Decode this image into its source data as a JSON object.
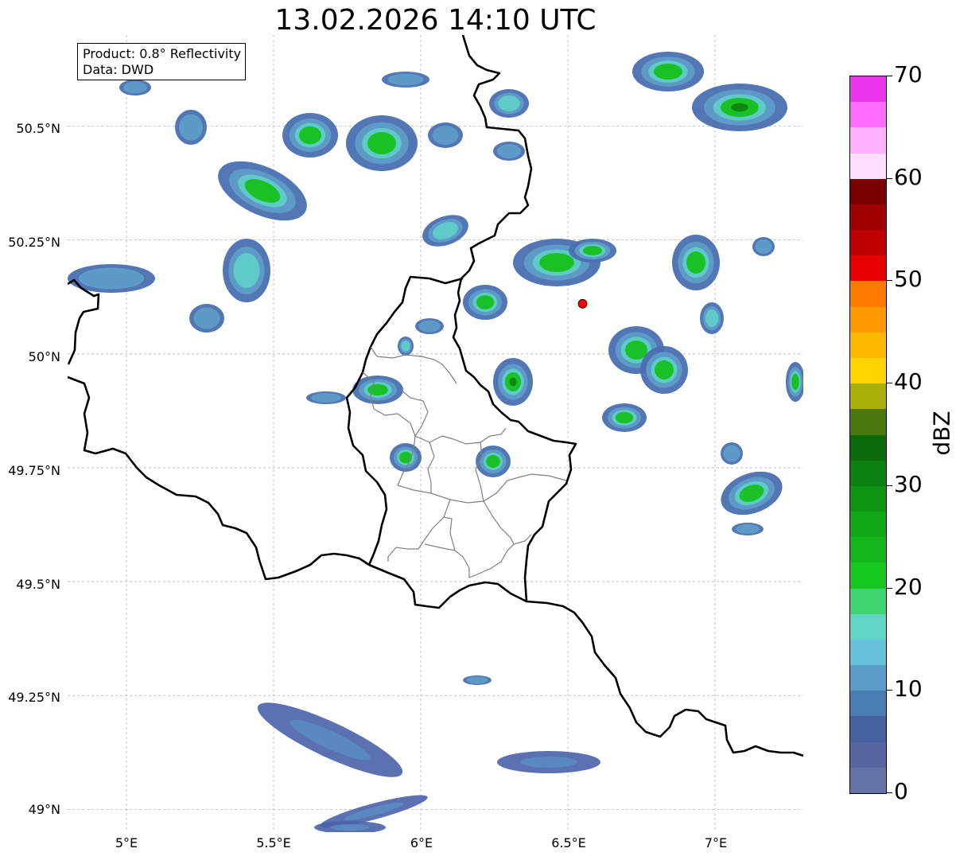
{
  "title": "13.02.2026 14:10 UTC",
  "info": {
    "product": "Product: 0.8° Reflectivity",
    "data": "Data: DWD"
  },
  "axes": {
    "lat_ticks": [
      "50.5°N",
      "50.25°N",
      "50°N",
      "49.75°N",
      "49.5°N",
      "49.25°N",
      "49°N"
    ],
    "lon_ticks": [
      "5°E",
      "5.5°E",
      "6°E",
      "6.5°E",
      "7°E"
    ]
  },
  "colorbar": {
    "unit": "dBZ",
    "tick_labels": [
      "0",
      "10",
      "20",
      "30",
      "40",
      "50",
      "60",
      "70"
    ],
    "colors": [
      "#6474a6",
      "#5465a0",
      "#4760a0",
      "#4a7cb4",
      "#5b9cc8",
      "#66c2dc",
      "#62d6c6",
      "#3ed670",
      "#16c81e",
      "#12b61a",
      "#11a614",
      "#0e9412",
      "#0c8010",
      "#0a6a0c",
      "#4a7a0e",
      "#aab00a",
      "#ffd400",
      "#ffb800",
      "#ff9a00",
      "#ff7a00",
      "#e60000",
      "#c00000",
      "#a00000",
      "#7a0000",
      "#ffdeff",
      "#ffb0ff",
      "#ff6cff",
      "#ec36ec"
    ]
  },
  "map": {
    "extent": {
      "lon": [
        4.8,
        7.3
      ],
      "lat": [
        48.95,
        50.7
      ]
    },
    "radar_marker": {
      "lon": 6.55,
      "lat": 50.11,
      "color": "#ff0000"
    }
  }
}
